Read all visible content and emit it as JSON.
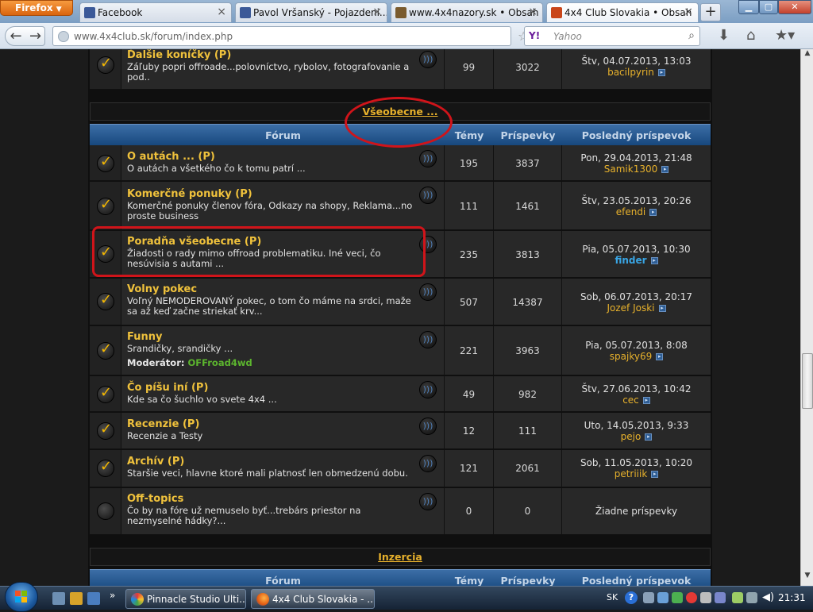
{
  "browser": {
    "app_button": "Firefox",
    "tabs": [
      {
        "label": "Facebook",
        "icon": "facebook-icon",
        "color": "#3b5998"
      },
      {
        "label": "Pavol Vršanský - Pojazdeni...",
        "icon": "facebook-icon",
        "color": "#3b5998"
      },
      {
        "label": "www.4x4nazory.sk • Obsah",
        "icon": "forum-icon",
        "color": "#7a5b2e"
      },
      {
        "label": "4x4 Club Slovakia • Obsah",
        "icon": "club-logo-icon",
        "color": "#c9461a"
      }
    ],
    "new_tab": "+",
    "url": "www.4x4club.sk/forum/index.php",
    "search_engine": "Y!",
    "search_placeholder": "Yahoo"
  },
  "forum": {
    "headers": {
      "forum": "Fórum",
      "topics": "Témy",
      "posts": "Príspevky",
      "last_post": "Posledný príspevok"
    },
    "moderator_label": "Moderátor:",
    "no_posts": "Žiadne príspevky",
    "top_row": {
      "title": "Ďalšie koníčky (P)",
      "desc": "Záľuby popri offroade...polovníctvo, rybolov, fotografovanie a pod..",
      "topics": "99",
      "posts": "3022",
      "date": "Štv, 04.07.2013, 13:03",
      "author": "bacilpyrin"
    },
    "category_general": "Všeobecne ...",
    "rows": [
      {
        "title": "O autách ... (P)",
        "desc": "O autách a všetkého čo k tomu patrí ...",
        "topics": "195",
        "posts": "3837",
        "date": "Pon, 29.04.2013, 21:48",
        "author": "Samik1300"
      },
      {
        "title": "Komerčné ponuky (P)",
        "desc": "Komerčné ponuky členov fóra, Odkazy na shopy, Reklama...no proste business",
        "topics": "111",
        "posts": "1461",
        "date": "Štv, 23.05.2013, 20:26",
        "author": "efendi"
      },
      {
        "title": "Poradňa všeobecne (P)",
        "desc": "Žiadosti o rady mimo offroad problematiku. Iné veci, čo nesúvisia s autami ...",
        "topics": "235",
        "posts": "3813",
        "date": "Pia, 05.07.2013, 10:30",
        "author": "finder"
      },
      {
        "title": "Volny pokec",
        "desc": "Voľný NEMODEROVANÝ pokec, o tom čo máme na srdci, maže sa až keď začne striekať krv...",
        "topics": "507",
        "posts": "14387",
        "date": "Sob, 06.07.2013, 20:17",
        "author": "Jozef Joski"
      },
      {
        "title": "Funny",
        "desc": "Srandičky, srandičky ...",
        "moderator": "OFFroad4wd",
        "topics": "221",
        "posts": "3963",
        "date": "Pia, 05.07.2013, 8:08",
        "author": "spajky69"
      },
      {
        "title": "Čo píšu iní (P)",
        "desc": "Kde sa čo šuchlo vo svete 4x4 ...",
        "topics": "49",
        "posts": "982",
        "date": "Štv, 27.06.2013, 10:42",
        "author": "cec"
      },
      {
        "title": "Recenzie (P)",
        "desc": "Recenzie a Testy",
        "topics": "12",
        "posts": "111",
        "date": "Uto, 14.05.2013, 9:33",
        "author": "pejo"
      },
      {
        "title": "Archív (P)",
        "desc": "Staršie veci, hlavne ktoré mali platnosť len obmedzenú dobu.",
        "topics": "121",
        "posts": "2061",
        "date": "Sob, 11.05.2013, 10:20",
        "author": "petriiik"
      },
      {
        "title": "Off-topics",
        "desc": "Čo by na fóre už nemuselo byť...trebárs priestor na nezmyselné hádky?...",
        "topics": "0",
        "posts": "0"
      }
    ],
    "category_ads": "Inzercia"
  },
  "taskbar": {
    "items": [
      {
        "label": "Pinnacle Studio Ulti...",
        "icon": "pinnacle-icon"
      },
      {
        "label": "4x4 Club Slovakia - ...",
        "icon": "firefox-icon"
      }
    ],
    "lang": "SK",
    "help": "?",
    "clock": "21:31"
  },
  "colors": {
    "accent_gold": "#f0c23c",
    "link_blue": "#39a5e4",
    "moderator_green": "#5cb52e",
    "annotation_red": "#d0141a"
  }
}
